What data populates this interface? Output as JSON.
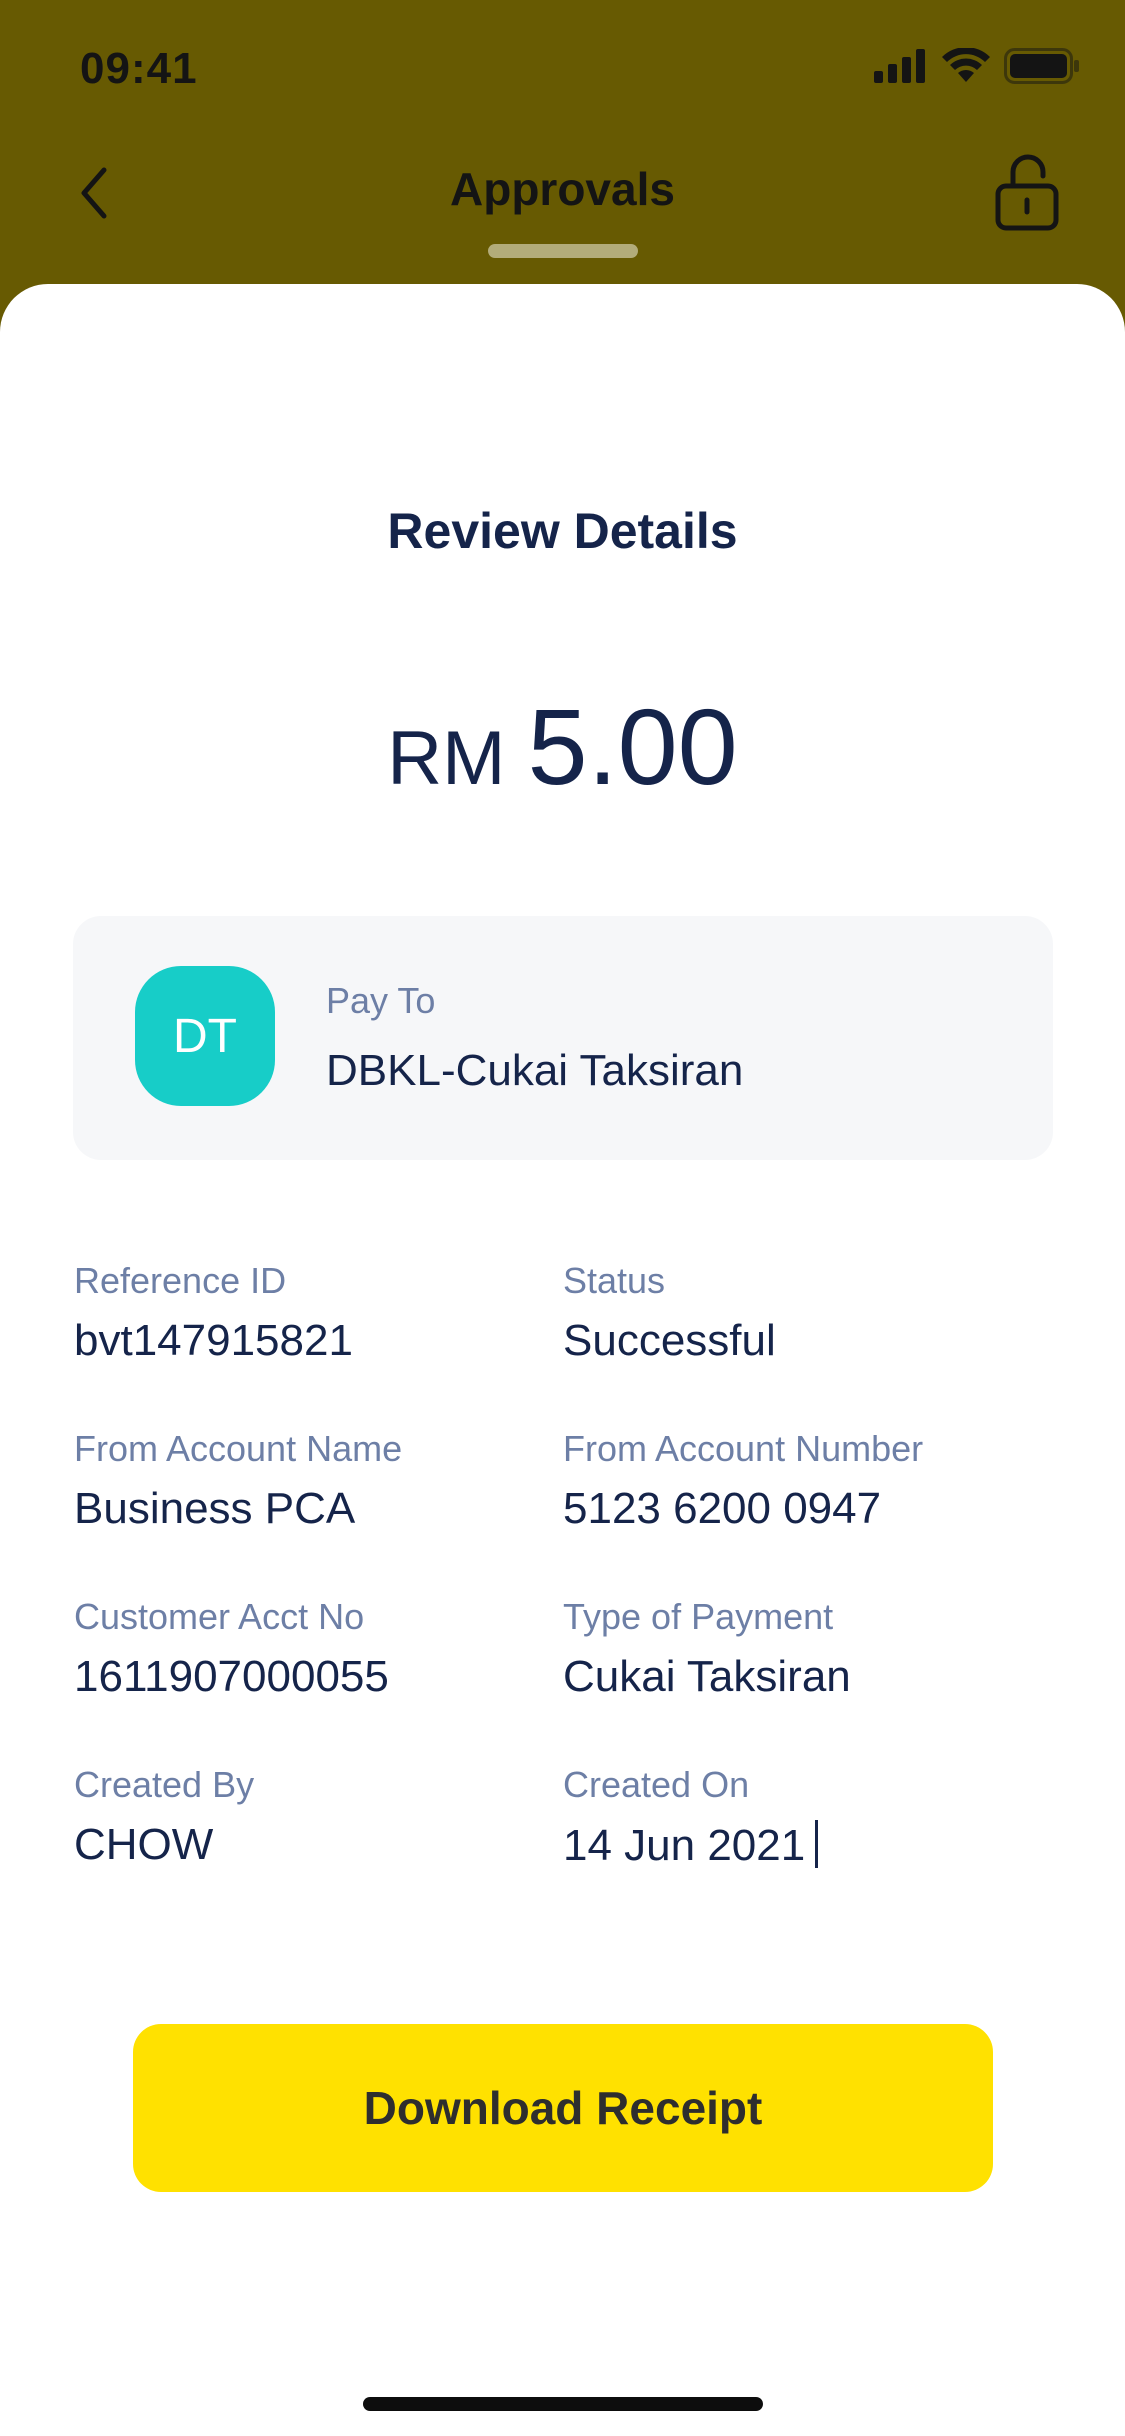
{
  "status_bar": {
    "time": "09:41"
  },
  "nav": {
    "title": "Approvals"
  },
  "colors": {
    "header_bg": "#675A02",
    "accent": "#FFE100",
    "avatar_bg": "#17CDC8",
    "text_primary": "#15244A",
    "text_secondary": "#6D7FA6"
  },
  "icons": {
    "back": "chevron-left-icon",
    "lock": "unlock-icon",
    "signal": "cellular-signal-icon",
    "wifi": "wifi-icon",
    "battery": "battery-icon"
  },
  "review": {
    "title": "Review Details",
    "currency": "RM",
    "amount": "5.00",
    "payee": {
      "initials": "DT",
      "label": "Pay To",
      "name": "DBKL-Cukai Taksiran"
    },
    "details": [
      {
        "label": "Reference ID",
        "value": "bvt147915821"
      },
      {
        "label": "Status",
        "value": "Successful"
      },
      {
        "label": "From Account Name",
        "value": "Business PCA"
      },
      {
        "label": "From Account Number",
        "value": "5123 6200 0947"
      },
      {
        "label": "Customer Acct No",
        "value": "1611907000055"
      },
      {
        "label": "Type of Payment",
        "value": "Cukai Taksiran"
      },
      {
        "label": "Created By",
        "value": "CHOW"
      },
      {
        "label": "Created On",
        "value": "14 Jun 2021"
      }
    ],
    "download_label": "Download Receipt"
  }
}
